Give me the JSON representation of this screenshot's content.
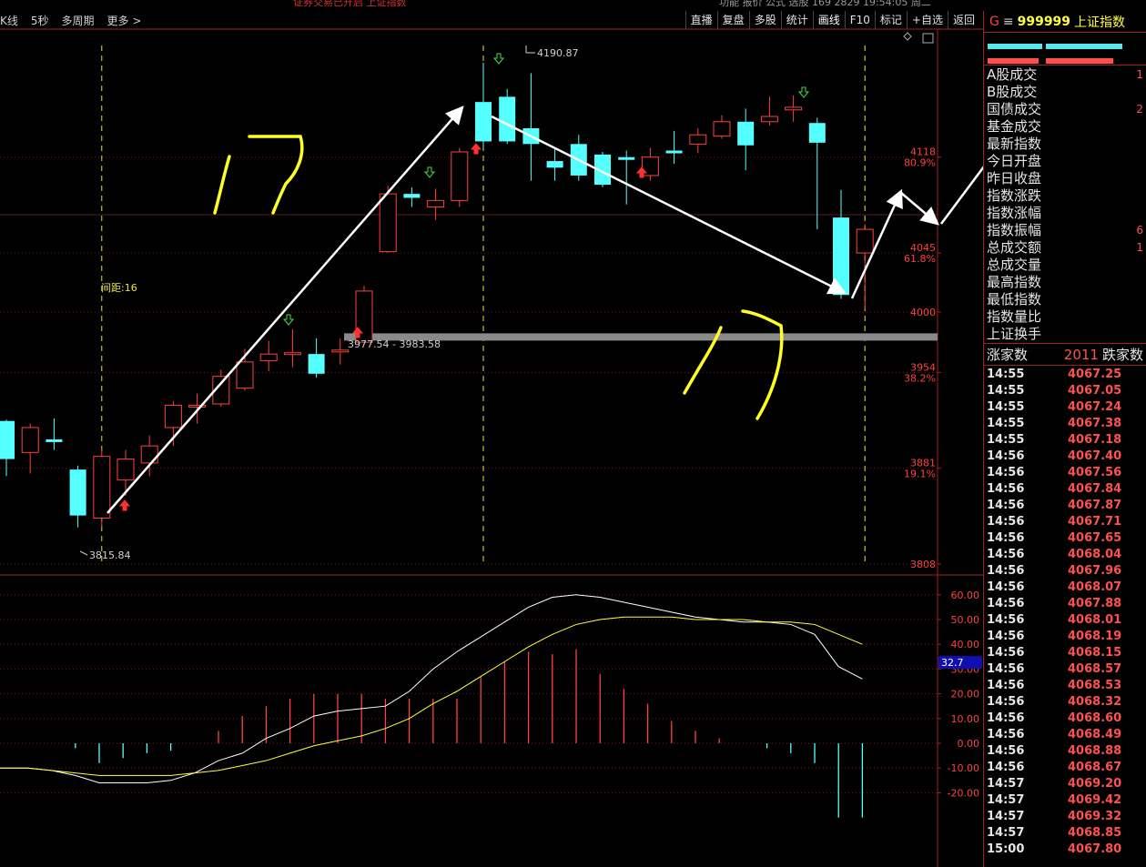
{
  "toolbar": {
    "left_items": [
      "K线",
      "5秒",
      "多周期",
      "更多 >"
    ],
    "right_buttons": [
      "直播",
      "复盘",
      "多股",
      "统计",
      "画线",
      "F10",
      "标记",
      "+自选",
      "返回"
    ],
    "active_button": "画线"
  },
  "top_strip": {
    "red_text": "证券交易已开启 上证指数",
    "numbers": "功能  报价  公式  选股      169   2829   19:54:05 周二"
  },
  "stock": {
    "market": "G",
    "symbol": "999999",
    "name": "上证指数"
  },
  "fields": [
    {
      "label": "A股成交",
      "value": "1"
    },
    {
      "label": "B股成交",
      "value": ""
    },
    {
      "label": "国债成交",
      "value": "2"
    },
    {
      "label": "基金成交",
      "value": ""
    },
    {
      "label": "最新指数",
      "value": ""
    },
    {
      "label": "今日开盘",
      "value": ""
    },
    {
      "label": "昨日收盘",
      "value": ""
    },
    {
      "label": "指数涨跌",
      "value": ""
    },
    {
      "label": "指数涨幅",
      "value": ""
    },
    {
      "label": "指数振幅",
      "value": "6"
    },
    {
      "label": "总成交额",
      "value": "1"
    },
    {
      "label": "总成交量",
      "value": ""
    },
    {
      "label": "最高指数",
      "value": ""
    },
    {
      "label": "最低指数",
      "value": ""
    },
    {
      "label": "指数量比",
      "value": ""
    },
    {
      "label": "上证换手",
      "value": ""
    }
  ],
  "up_down": {
    "up_label": "涨家数",
    "down_count": "2011",
    "down_label": "跌家数"
  },
  "ticks": [
    {
      "time": "14:55",
      "price": "4067.25"
    },
    {
      "time": "14:55",
      "price": "4067.05"
    },
    {
      "time": "14:55",
      "price": "4067.24"
    },
    {
      "time": "14:55",
      "price": "4067.38"
    },
    {
      "time": "14:55",
      "price": "4067.18"
    },
    {
      "time": "14:56",
      "price": "4067.40"
    },
    {
      "time": "14:56",
      "price": "4067.56"
    },
    {
      "time": "14:56",
      "price": "4067.84"
    },
    {
      "time": "14:56",
      "price": "4067.87"
    },
    {
      "time": "14:56",
      "price": "4067.71"
    },
    {
      "time": "14:56",
      "price": "4067.65"
    },
    {
      "time": "14:56",
      "price": "4068.04"
    },
    {
      "time": "14:56",
      "price": "4067.96"
    },
    {
      "time": "14:56",
      "price": "4068.07"
    },
    {
      "time": "14:56",
      "price": "4067.88"
    },
    {
      "time": "14:56",
      "price": "4068.01"
    },
    {
      "time": "14:56",
      "price": "4068.19"
    },
    {
      "time": "14:56",
      "price": "4068.15"
    },
    {
      "time": "14:56",
      "price": "4068.57"
    },
    {
      "time": "14:56",
      "price": "4068.53"
    },
    {
      "time": "14:56",
      "price": "4068.32"
    },
    {
      "time": "14:56",
      "price": "4068.60"
    },
    {
      "time": "14:56",
      "price": "4068.49"
    },
    {
      "time": "14:56",
      "price": "4068.88"
    },
    {
      "time": "14:56",
      "price": "4068.67"
    },
    {
      "time": "14:57",
      "price": "4069.20"
    },
    {
      "time": "14:57",
      "price": "4069.42"
    },
    {
      "time": "14:57",
      "price": "4069.32"
    },
    {
      "time": "14:57",
      "price": "4068.85"
    },
    {
      "time": "15:00",
      "price": "4067.80"
    }
  ],
  "colors": {
    "up": "#ff4040",
    "down": "#54ffff",
    "grid": "#7a1010",
    "ma_white": "#ffffff",
    "ma_yellow": "#ffff40"
  },
  "chart_data": [
    {
      "type": "candlestick",
      "price_axis": {
        "ylim": [
          3808,
          4210
        ]
      },
      "price_ticks": [
        {
          "value": 4118,
          "label": "4118",
          "pct": "80.9%"
        },
        {
          "value": 4045,
          "label": "4045",
          "pct": "61.8%"
        },
        {
          "value": 4000,
          "label": "4000",
          "pct": ""
        },
        {
          "value": 3954,
          "label": "3954",
          "pct": "38.2%"
        },
        {
          "value": 3881,
          "label": "3881",
          "pct": "19.1%"
        },
        {
          "value": 3808,
          "label": "3808",
          "pct": ""
        }
      ],
      "candles": [
        {
          "o": 3917,
          "h": 3918,
          "c": 3888,
          "l": 3875
        },
        {
          "o": 3893,
          "h": 3915,
          "c": 3912,
          "l": 3877
        },
        {
          "o": 3903,
          "h": 3919,
          "c": 3902,
          "l": 3895
        },
        {
          "o": 3880,
          "h": 3883,
          "c": 3845,
          "l": 3836
        },
        {
          "o": 3843,
          "h": 3896,
          "c": 3890,
          "l": 3836
        },
        {
          "o": 3872,
          "h": 3895,
          "c": 3888,
          "l": 3860
        },
        {
          "o": 3885,
          "h": 3906,
          "c": 3898,
          "l": 3875
        },
        {
          "o": 3912,
          "h": 3932,
          "c": 3929,
          "l": 3898
        },
        {
          "o": 3928,
          "h": 3938,
          "c": 3929,
          "l": 3915
        },
        {
          "o": 3930,
          "h": 3956,
          "c": 3951,
          "l": 3928
        },
        {
          "o": 3942,
          "h": 3972,
          "c": 3962,
          "l": 3940
        },
        {
          "o": 3963,
          "h": 3978,
          "c": 3968,
          "l": 3955
        },
        {
          "o": 3968,
          "h": 3987,
          "c": 3969,
          "l": 3958
        },
        {
          "o": 3968,
          "h": 3980,
          "c": 3953,
          "l": 3950
        },
        {
          "o": 3970,
          "h": 3980,
          "c": 3971,
          "l": 3960
        },
        {
          "o": 3977,
          "h": 4020,
          "c": 4016,
          "l": 3976
        },
        {
          "o": 4046,
          "h": 4096,
          "c": 4090,
          "l": 4045
        },
        {
          "o": 4090,
          "h": 4095,
          "c": 4087,
          "l": 4080
        },
        {
          "o": 4080,
          "h": 4094,
          "c": 4085,
          "l": 4070
        },
        {
          "o": 4085,
          "h": 4125,
          "c": 4122,
          "l": 4080
        },
        {
          "o": 4160,
          "h": 4190,
          "c": 4130,
          "l": 4125
        },
        {
          "o": 4164,
          "h": 4170,
          "c": 4130,
          "l": 4128
        },
        {
          "o": 4140,
          "h": 4182,
          "c": 4128,
          "l": 4100
        },
        {
          "o": 4115,
          "h": 4125,
          "c": 4110,
          "l": 4100
        },
        {
          "o": 4128,
          "h": 4135,
          "c": 4104,
          "l": 4100
        },
        {
          "o": 4120,
          "h": 4122,
          "c": 4097,
          "l": 4095
        },
        {
          "o": 4118,
          "h": 4123,
          "c": 4116,
          "l": 4082
        },
        {
          "o": 4104,
          "h": 4125,
          "c": 4118,
          "l": 4100
        },
        {
          "o": 4123,
          "h": 4138,
          "c": 4121,
          "l": 4113
        },
        {
          "o": 4128,
          "h": 4140,
          "c": 4135,
          "l": 4121
        },
        {
          "o": 4134,
          "h": 4150,
          "c": 4145,
          "l": 4132
        },
        {
          "o": 4145,
          "h": 4155,
          "c": 4127,
          "l": 4108
        },
        {
          "o": 4145,
          "h": 4164,
          "c": 4149,
          "l": 4142
        },
        {
          "o": 4154,
          "h": 4165,
          "c": 4156,
          "l": 4145
        },
        {
          "o": 4144,
          "h": 4148,
          "c": 4129,
          "l": 4063
        },
        {
          "o": 4072,
          "h": 4093,
          "c": 4013,
          "l": 4010
        },
        {
          "o": 4045,
          "h": 4067,
          "c": 4063,
          "l": 4002
        }
      ],
      "labels": [
        {
          "text": "4190.87"
        },
        {
          "text": "3977.54 - 3983.58"
        },
        {
          "text": "3815.84"
        },
        {
          "text": "间距:16"
        }
      ],
      "support_zone": {
        "value": 3981
      }
    },
    {
      "type": "macd",
      "ylim": [
        -30,
        66
      ],
      "ticks": [
        "60.00",
        "50.00",
        "40.00",
        "30.00",
        "20.00",
        "10.00",
        "0.00",
        "-10.00",
        "-20.00"
      ],
      "current_value": "32.7",
      "histogram": [
        0,
        0,
        0,
        0,
        -2,
        -8,
        -6,
        -4,
        -3,
        0,
        5,
        11,
        15,
        18,
        20,
        20,
        20,
        18,
        18,
        18,
        18,
        27,
        33,
        37,
        36,
        38,
        28,
        22,
        16,
        9,
        5,
        2,
        0,
        -2,
        -4,
        -8,
        -30,
        -30
      ],
      "white_line": [
        -10,
        -10,
        -10,
        -11,
        -13,
        -16,
        -16,
        -16,
        -15,
        -12,
        -7,
        -4,
        2,
        6,
        11,
        13,
        14,
        15,
        21,
        30,
        37,
        43,
        49,
        55,
        59,
        60,
        59,
        57,
        55,
        53,
        51,
        50,
        49,
        49,
        48,
        44,
        31,
        26
      ],
      "yellow_line": [
        -10,
        -10,
        -10,
        -11,
        -12,
        -13,
        -13,
        -13,
        -13,
        -12,
        -11,
        -9,
        -7,
        -4,
        -1,
        1,
        3,
        6,
        10,
        16,
        21,
        27,
        33,
        39,
        44,
        48,
        50,
        51,
        51,
        51,
        50,
        50,
        50,
        49,
        49,
        48,
        44,
        40
      ]
    }
  ]
}
